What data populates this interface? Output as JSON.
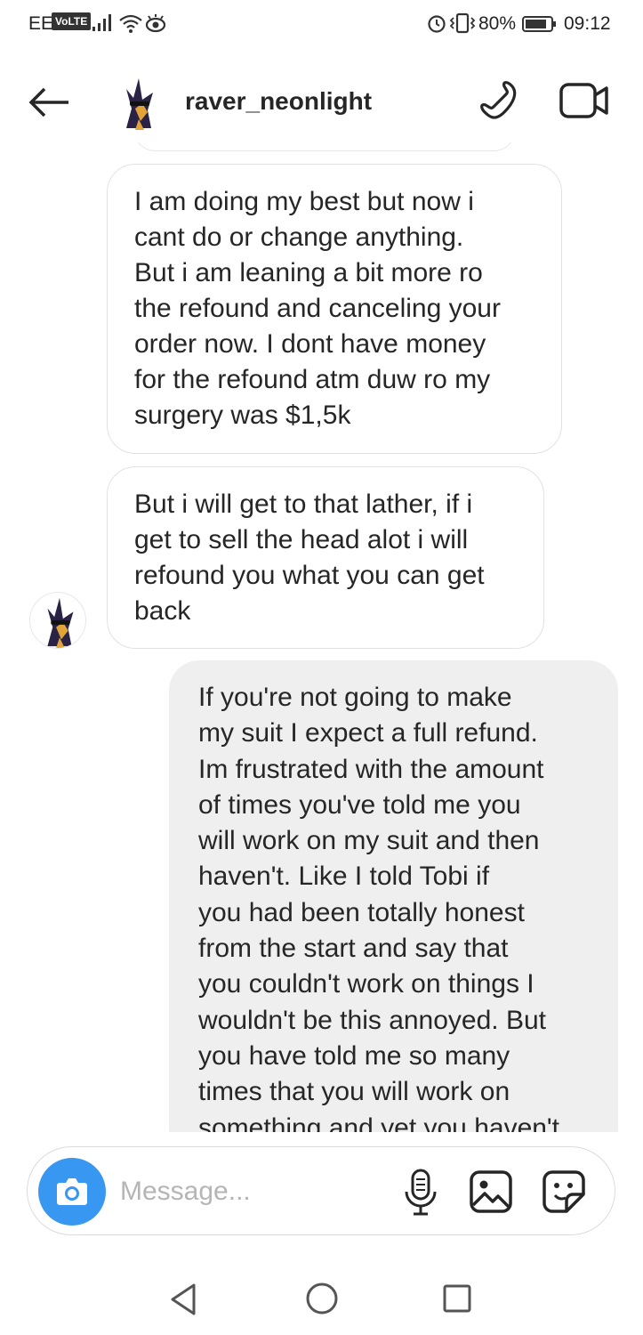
{
  "status_bar": {
    "carrier": "EE",
    "volte": "VoLTE",
    "battery_percent": "80%",
    "time": "09:12"
  },
  "header": {
    "username": "raver_neonlight",
    "icons": [
      "back-arrow-icon",
      "avatar",
      "phone-call-icon",
      "video-call-icon"
    ]
  },
  "messages": [
    {
      "direction": "incoming",
      "lines": [
        "I am doing my best but now i",
        "cant do or change anything.",
        "But i am leaning a bit more ro",
        "the refound and canceling your",
        "order now. I dont have money",
        "for the refound atm duw ro my",
        "surgery was $1,5k"
      ]
    },
    {
      "direction": "incoming",
      "lines": [
        "But i will get to that lather, if i",
        "get to sell the head alot i will",
        "refound you what you can get",
        "back"
      ]
    },
    {
      "direction": "outgoing",
      "lines": [
        "If you're not going to make",
        "my suit I expect a full refund.",
        "Im frustrated with the amount",
        "of times you've told me you",
        "will work on my suit and then",
        "haven't. Like I told Tobi if",
        "you had been totally honest",
        "from the start and say that",
        "you couldn't work on things I",
        "wouldn't be this annoyed. But",
        "you have told me so many",
        "times that you will work on",
        "something and yet you haven't"
      ]
    }
  ],
  "composer": {
    "placeholder": "Message...",
    "value": "",
    "icons": [
      "camera-icon",
      "microphone-icon",
      "gallery-icon",
      "sticker-icon"
    ]
  },
  "nav_bar": {
    "icons": [
      "nav-back-icon",
      "nav-home-icon",
      "nav-recents-icon"
    ]
  },
  "colors": {
    "accent_blue": "#3897f0",
    "outgoing_bubble": "#efefef",
    "incoming_border": "#e2e2e2",
    "text": "#262626",
    "placeholder": "#b5b5b5"
  }
}
